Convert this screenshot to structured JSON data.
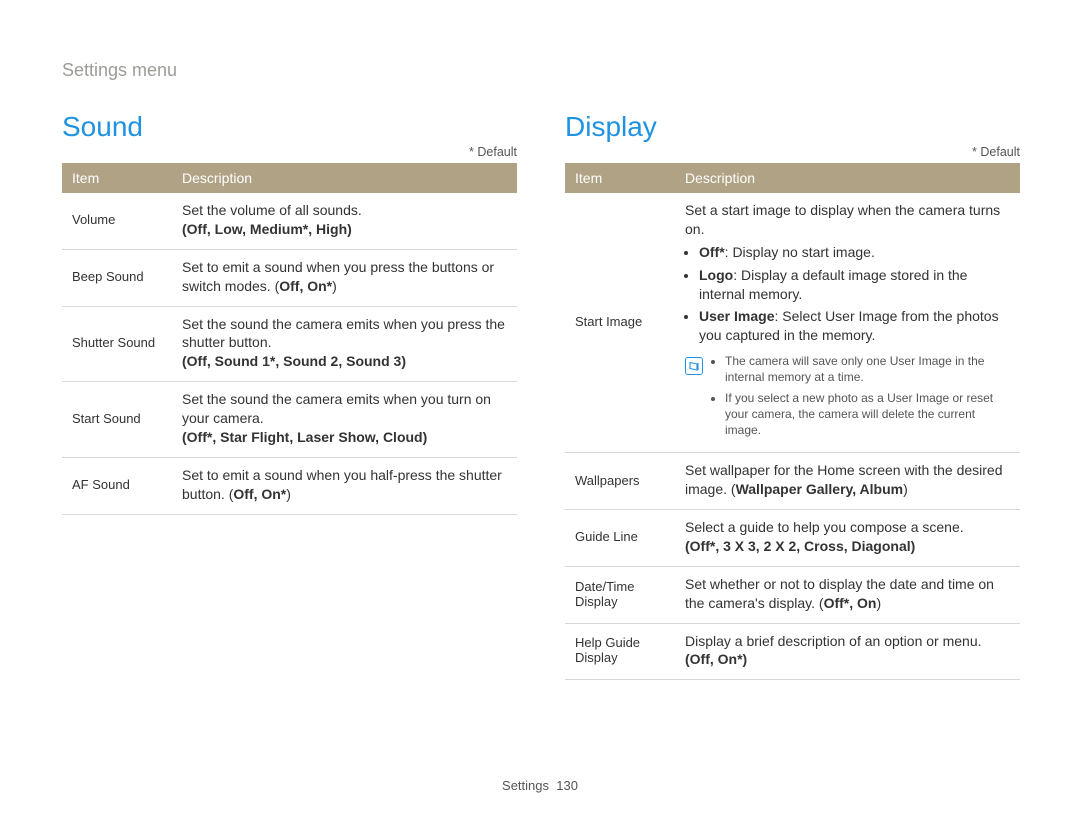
{
  "breadcrumb": "Settings menu",
  "default_label": "* Default",
  "headers": {
    "item": "Item",
    "description": "Description"
  },
  "footer": {
    "section": "Settings",
    "page": "130"
  },
  "sound": {
    "title": "Sound",
    "rows": {
      "volume": {
        "item": "Volume",
        "desc": "Set the volume of all sounds.",
        "opts": "(Off, Low, Medium*, High)"
      },
      "beep": {
        "item": "Beep Sound",
        "desc_a": "Set to emit a sound when you press the buttons or switch modes. (",
        "opts": "Off, On*",
        "desc_b": ")"
      },
      "shutter": {
        "item": "Shutter Sound",
        "desc": "Set the sound the camera emits when you press the shutter button.",
        "opts": "(Off, Sound 1*, Sound 2, Sound 3)"
      },
      "start": {
        "item": "Start Sound",
        "desc": "Set the sound the camera emits when you turn on your camera.",
        "opts": "(Off*, Star Flight, Laser Show, Cloud)"
      },
      "af": {
        "item": "AF Sound",
        "desc_a": "Set to emit a sound when you half-press the shutter button. (",
        "opts": "Off, On*",
        "desc_b": ")"
      }
    }
  },
  "display": {
    "title": "Display",
    "rows": {
      "start_image": {
        "item": "Start Image",
        "desc": "Set a start image to display when the camera turns on.",
        "b1_label": "Off*",
        "b1_rest": ": Display no start image.",
        "b2_label": "Logo",
        "b2_rest": ": Display a default image stored in the internal memory.",
        "b3_label": "User Image",
        "b3_rest": ": Select User Image from the photos you captured in the memory.",
        "note1": "The camera will save only one User Image in the internal memory at a time.",
        "note2": "If you select a new photo as a User Image or reset your camera, the camera will delete the current image."
      },
      "wallpapers": {
        "item": "Wallpapers",
        "desc_a": "Set wallpaper for the Home screen with the desired image. (",
        "opts": "Wallpaper Gallery, Album",
        "desc_b": ")"
      },
      "guide_line": {
        "item": "Guide Line",
        "desc": "Select a guide to help you compose a scene.",
        "opts": "(Off*, 3 X 3, 2 X 2, Cross, Diagonal)"
      },
      "datetime": {
        "item": "Date/Time Display",
        "desc_a": "Set whether or not to display the date and time on the camera's display. (",
        "opts": "Off*, On",
        "desc_b": ")"
      },
      "help": {
        "item": "Help Guide Display",
        "desc": "Display a brief description of an option or menu.",
        "opts": "(Off, On*)"
      }
    }
  }
}
